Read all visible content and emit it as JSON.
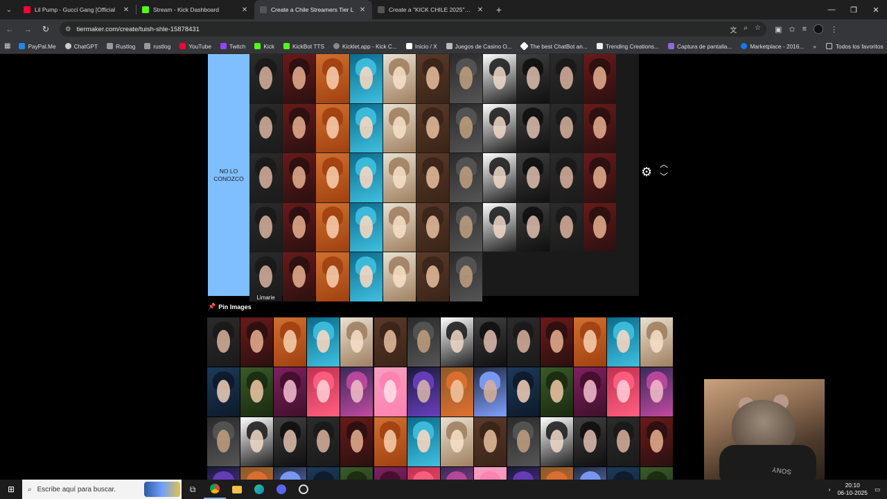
{
  "browser": {
    "tabs": [
      {
        "title": "Lil Pump - Gucci Gang [Official",
        "favicon_color": "#ff0033",
        "active": false
      },
      {
        "title": "Stream - Kick Dashboard",
        "favicon_color": "#53fc18",
        "active": false
      },
      {
        "title": "Create a Chile Streamers Tier L",
        "favicon_color": "#555555",
        "active": true
      },
      {
        "title": "Create a \"KICK CHILE 2025\" Tier",
        "favicon_color": "#555555",
        "active": false
      }
    ],
    "new_tab_label": "+",
    "url": "tiermaker.com/create/tuish-shle-15878431",
    "bookmarks": [
      {
        "label": "PayPal.Me",
        "color": "#1e88e5"
      },
      {
        "label": "ChatGPT",
        "color": "#cccccc"
      },
      {
        "label": "Rustlog",
        "color": "#999999"
      },
      {
        "label": "rustlog",
        "color": "#999999"
      },
      {
        "label": "YouTube",
        "color": "#ff0033"
      },
      {
        "label": "Twitch",
        "color": "#9146ff"
      },
      {
        "label": "Kick",
        "color": "#53fc18"
      },
      {
        "label": "KickBot TTS",
        "color": "#53fc18"
      },
      {
        "label": "Kicklet.app - Kick C...",
        "color": "#888888"
      },
      {
        "label": "Inicio / X",
        "color": "#ffffff"
      },
      {
        "label": "Juegos de Casino O...",
        "color": "#bbbbbb"
      },
      {
        "label": "The best ChatBot an...",
        "color": "#ffffff"
      },
      {
        "label": "Trending Creations...",
        "color": "#eeeeee"
      },
      {
        "label": "Captura de pantalla...",
        "color": "#8e6bd8"
      },
      {
        "label": "Marketplace - 2016...",
        "color": "#1877f2"
      }
    ],
    "bookmarks_overflow": "»",
    "all_bookmarks": "Todos los favoritos"
  },
  "tierlist": {
    "tier_label": "NO LO CONOZCO",
    "tier_color": "#7fbfff",
    "tier_image_caption": "Limarie",
    "pin_label": "Pin Images"
  },
  "taskbar": {
    "search_placeholder": "Escribe aquí para buscar.",
    "time": "20:10",
    "date": "06-10-2025"
  },
  "webcam": {
    "controller_brand": "SONY"
  }
}
